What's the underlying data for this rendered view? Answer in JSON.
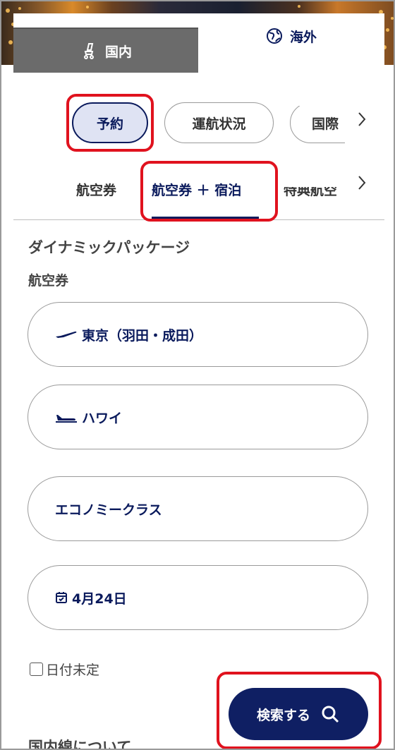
{
  "tabs": {
    "domestic_label": "国内",
    "overseas_label": "海外"
  },
  "categories": [
    "予約",
    "運航状況",
    "国際"
  ],
  "subtabs": [
    "航空券",
    "航空券 ＋ 宿泊",
    "特典航空"
  ],
  "section": {
    "heading": "ダイナミックパッケージ",
    "subheading": "航空券"
  },
  "fields": {
    "origin": "東京（羽田・成田）",
    "destination": "ハワイ",
    "cabin_class": "エコノミークラス",
    "date": "4月24日"
  },
  "date_undecided_label": "日付未定",
  "search_button_label": "検索する",
  "cutoff_heading": "国内線について",
  "icons": {
    "domestic": "seat-icon",
    "overseas": "globe-icon",
    "departure": "plane-takeoff-icon",
    "arrival": "plane-landing-icon",
    "calendar": "calendar-icon",
    "search": "search-icon",
    "chevron": "chevron-right-icon"
  },
  "colors": {
    "brand_navy": "#0a1a5c",
    "search_button": "#0f1f63",
    "active_pill_bg": "#dfe3f3",
    "inactive_tab": "#6b6b6b",
    "highlight_red": "#e0121e"
  }
}
